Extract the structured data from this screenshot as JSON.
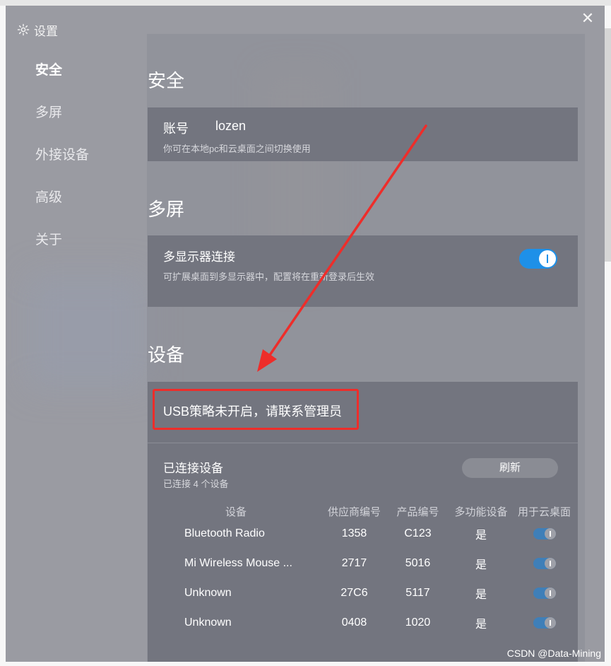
{
  "dialog": {
    "title": "设置",
    "close_glyph": "✕"
  },
  "sidebar": {
    "items": [
      {
        "label": "安全",
        "active": true
      },
      {
        "label": "多屏",
        "active": false
      },
      {
        "label": "外接设备",
        "active": false
      },
      {
        "label": "高级",
        "active": false
      },
      {
        "label": "关于",
        "active": false
      }
    ]
  },
  "security": {
    "title": "安全",
    "account_label": "账号",
    "account_value": "lozen",
    "account_desc": "你可在本地pc和云桌面之间切换使用"
  },
  "multiscreen": {
    "title": "多屏",
    "item_label": "多显示器连接",
    "item_desc": "可扩展桌面到多显示器中，配置将在重新登录后生效",
    "enabled": true
  },
  "devices": {
    "title": "设备",
    "usb_message": "USB策略未开启，请联系管理员",
    "connected_title": "已连接设备",
    "connected_count": "已连接 4 个设备",
    "refresh_label": "刷新",
    "columns": [
      "设备",
      "供应商编号",
      "产品编号",
      "多功能设备",
      "用于云桌面"
    ],
    "rows": [
      {
        "name": "Bluetooth Radio",
        "vendor": "1358",
        "product": "C123",
        "multi": "是",
        "use": true
      },
      {
        "name": "Mi Wireless Mouse ...",
        "vendor": "2717",
        "product": "5016",
        "multi": "是",
        "use": true
      },
      {
        "name": "Unknown",
        "vendor": "27C6",
        "product": "5117",
        "multi": "是",
        "use": true
      },
      {
        "name": "Unknown",
        "vendor": "0408",
        "product": "1020",
        "multi": "是",
        "use": true
      }
    ]
  },
  "watermark": "CSDN @Data-Mining",
  "colors": {
    "panel": "#73757f",
    "toggle_on": "#1e90e8",
    "annotation_red": "#ee2d2a"
  },
  "icons": [
    "gear-icon",
    "close-icon",
    "toggle-switch"
  ]
}
